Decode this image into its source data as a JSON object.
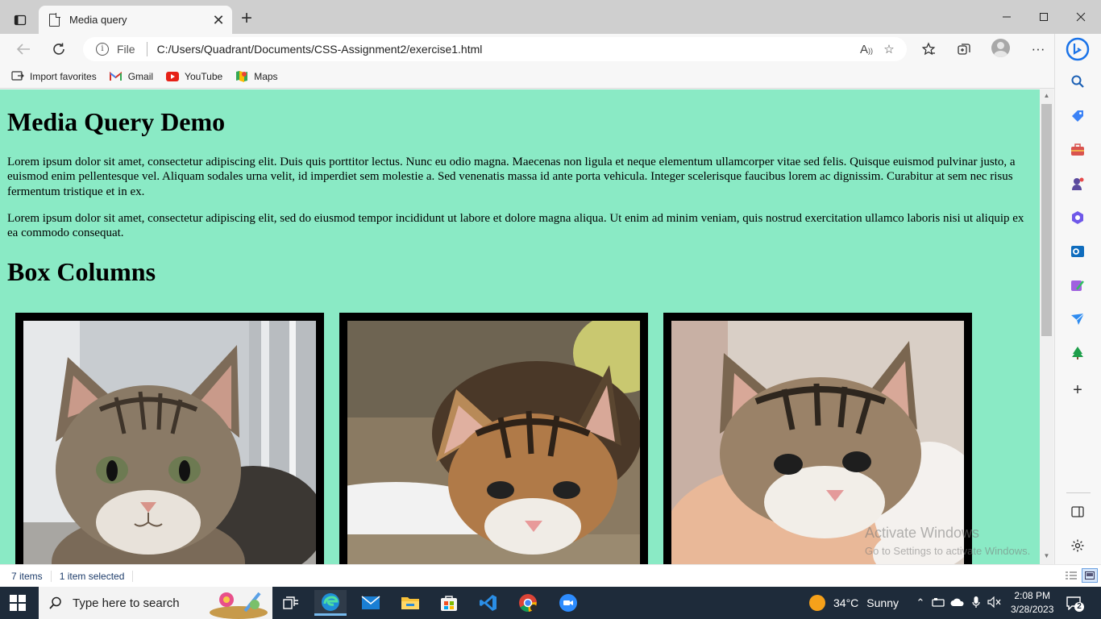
{
  "browser": {
    "tab_title": "Media query",
    "file_label": "File",
    "url": "C:/Users/Quadrant/Documents/CSS-Assignment2/exercise1.html"
  },
  "favorites": [
    {
      "label": "Import favorites",
      "icon": "import-icon"
    },
    {
      "label": "Gmail",
      "icon": "gmail-icon"
    },
    {
      "label": "YouTube",
      "icon": "youtube-icon"
    },
    {
      "label": "Maps",
      "icon": "maps-icon"
    }
  ],
  "page": {
    "heading": "Media Query Demo",
    "paragraph1": "Lorem ipsum dolor sit amet, consectetur adipiscing elit. Duis quis porttitor lectus. Nunc eu odio magna. Maecenas non ligula et neque elementum ullamcorper vitae sed felis. Quisque euismod pulvinar justo, a euismod enim pellentesque vel. Aliquam sodales urna velit, id imperdiet sem molestie a. Sed venenatis massa id ante porta vehicula. Integer scelerisque faucibus lorem ac dignissim. Curabitur at sem nec risus fermentum tristique et in ex.",
    "paragraph2": "Lorem ipsum dolor sit amet, consectetur adipiscing elit, sed do eiusmod tempor incididunt ut labore et dolore magna aliqua. Ut enim ad minim veniam, quis nostrud exercitation ullamco laboris nisi ut aliquip ex ea commodo consequat.",
    "subheading": "Box Columns",
    "background": "#8aeac5"
  },
  "watermark": {
    "line1": "Activate Windows",
    "line2": "Go to Settings to activate Windows."
  },
  "status": {
    "items": "7 items",
    "selected": "1 item selected"
  },
  "taskbar": {
    "search_placeholder": "Type here to search",
    "weather_temp": "34°C",
    "weather_text": "Sunny",
    "time": "2:08 PM",
    "date": "3/28/2023",
    "notifications": "2"
  }
}
